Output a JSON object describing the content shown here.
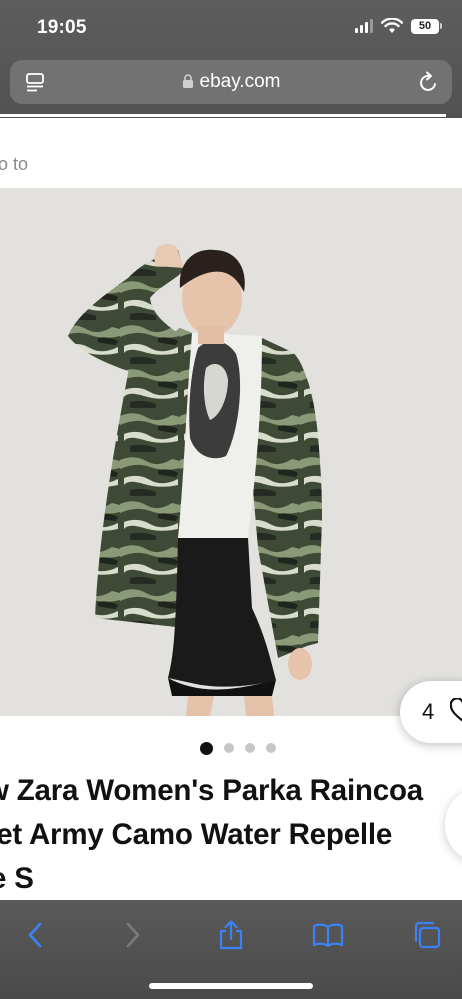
{
  "status_bar": {
    "time": "19:05",
    "battery": "50"
  },
  "browser": {
    "url": "ebay.com"
  },
  "page": {
    "back_link": "o to",
    "watch_count": "4",
    "image_index": 1,
    "image_total": 4,
    "title_lines": [
      "w Zara Women's Parka Raincoa",
      "ket Army Camo Water Repelle",
      "e S"
    ]
  },
  "icons": {
    "reader": "reader-mode-icon",
    "lock": "lock-icon",
    "reload": "reload-icon",
    "watch": "heart-icon",
    "back": "chevron-left-icon",
    "forward": "chevron-right-icon",
    "share": "share-icon",
    "bookmarks": "book-icon",
    "tabs": "tabs-icon"
  },
  "colors": {
    "chrome_bg": "#555555",
    "accent": "#3b82f6",
    "title_text": "#111111",
    "image_bg": "#e2e1de"
  }
}
